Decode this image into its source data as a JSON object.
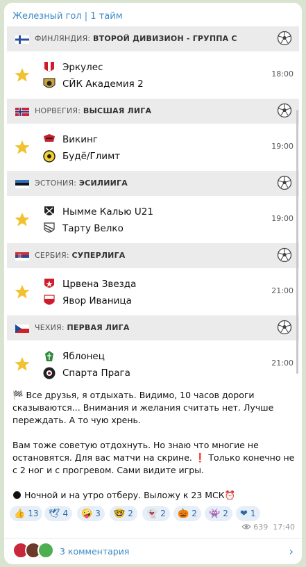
{
  "channel_title": "Железный гол | 1 тайм",
  "leagues": [
    {
      "country": "ФИНЛЯНДИЯ:",
      "league": "ВТОРОЙ ДИВИЗИОН - ГРУППА С",
      "flag_colors": [
        "#ffffff",
        "#2a4fa0"
      ],
      "home": "Эркулес",
      "away": "СЙК Академия 2",
      "time": "18:00"
    },
    {
      "country": "НОРВЕГИЯ:",
      "league": "ВЫСШАЯ ЛИГА",
      "flag_colors": [
        "#c9283a",
        "#2a3a80"
      ],
      "home": "Викинг",
      "away": "Будё/Глимт",
      "time": "19:00"
    },
    {
      "country": "ЭСТОНИЯ:",
      "league": "ЭСИЛИИГА",
      "flag_colors": [
        "#2f6fc4",
        "#111111",
        "#ffffff"
      ],
      "home": "Нымме Калью U21",
      "away": "Тарту Велко",
      "time": "19:00"
    },
    {
      "country": "СЕРБИЯ:",
      "league": "СУПЕРЛИГА",
      "flag_colors": [
        "#c8303a",
        "#2a4a90",
        "#ffffff"
      ],
      "home": "Црвена Звезда",
      "away": "Явор Иваница",
      "time": "21:00"
    },
    {
      "country": "ЧЕХИЯ:",
      "league": "ПЕРВАЯ ЛИГА",
      "flag_colors": [
        "#ffffff",
        "#d0202a",
        "#1a4a9a"
      ],
      "home": "Яблонец",
      "away": "Спарта Прага",
      "time": "21:00"
    }
  ],
  "message": {
    "p1": "🏁 Все друзья, я отдыхать. Видимо, 10 часов дороги сказываются... Внимания и желания считать нет. Лучше переждать. А то чую хрень.",
    "p2": "Вам тоже советую отдохнуть. Но знаю что многие не остановятся. Для вас матчи на скрине. ❗ Только конечно не с 2 ног и с прогревом. Сами видите игры.",
    "p3": "🌑 Ночной и на утро отберу. Выложу к 23 МСК⏰"
  },
  "reactions": [
    {
      "emoji": "👍",
      "count": "13"
    },
    {
      "emoji": "🕊",
      "count": "4"
    },
    {
      "emoji": "🤪",
      "count": "3"
    },
    {
      "emoji": "🤓",
      "count": "2"
    },
    {
      "emoji": "👻",
      "count": "2"
    },
    {
      "emoji": "🎃",
      "count": "2"
    },
    {
      "emoji": "👾",
      "count": "2"
    },
    {
      "emoji": "❤",
      "count": "1"
    }
  ],
  "views": "639",
  "time": "17:40",
  "comments_label": "3 комментария",
  "colors": {
    "accent": "#3a8ac4",
    "star": "#f2c12e",
    "header_bg": "#ebebeb"
  }
}
